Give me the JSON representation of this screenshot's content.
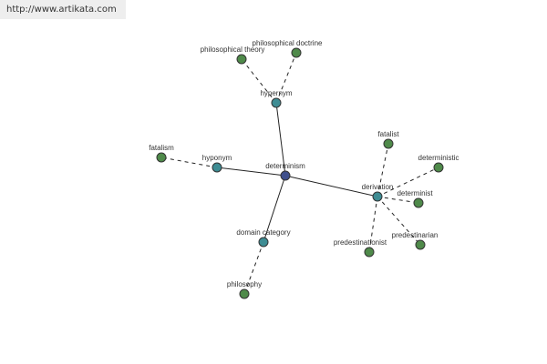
{
  "banner": {
    "url": "http://www.artikata.com"
  },
  "graph": {
    "colors": {
      "center": "#3f4f8c",
      "relation": "#3e8c93",
      "leaf": "#4f8a4a",
      "edge": "#222222"
    },
    "nodes": [
      {
        "id": "determinism",
        "label": "determinism",
        "type": "center"
      },
      {
        "id": "hypernym",
        "label": "hypernym",
        "type": "relation"
      },
      {
        "id": "hyponym",
        "label": "hyponym",
        "type": "relation"
      },
      {
        "id": "derivation",
        "label": "derivation",
        "type": "relation"
      },
      {
        "id": "domain-category",
        "label": "domain category",
        "type": "relation"
      },
      {
        "id": "philosophical-theory",
        "label": "philosophical theory",
        "type": "leaf"
      },
      {
        "id": "philosophical-doctrine",
        "label": "philosophical doctrine",
        "type": "leaf"
      },
      {
        "id": "fatalism",
        "label": "fatalism",
        "type": "leaf"
      },
      {
        "id": "fatalist",
        "label": "fatalist",
        "type": "leaf"
      },
      {
        "id": "deterministic",
        "label": "deterministic",
        "type": "leaf"
      },
      {
        "id": "determinist",
        "label": "determinist",
        "type": "leaf"
      },
      {
        "id": "predestinarian",
        "label": "predestinarian",
        "type": "leaf"
      },
      {
        "id": "predestinationist",
        "label": "predestinationist",
        "type": "leaf"
      },
      {
        "id": "philosophy",
        "label": "philosophy",
        "type": "leaf"
      }
    ],
    "edges": [
      {
        "from": "determinism",
        "to": "hypernym",
        "style": "solid"
      },
      {
        "from": "determinism",
        "to": "hyponym",
        "style": "solid"
      },
      {
        "from": "determinism",
        "to": "derivation",
        "style": "solid"
      },
      {
        "from": "determinism",
        "to": "domain-category",
        "style": "solid"
      },
      {
        "from": "hypernym",
        "to": "philosophical-theory",
        "style": "dashed"
      },
      {
        "from": "hypernym",
        "to": "philosophical-doctrine",
        "style": "dashed"
      },
      {
        "from": "hyponym",
        "to": "fatalism",
        "style": "dashed"
      },
      {
        "from": "derivation",
        "to": "fatalist",
        "style": "dashed"
      },
      {
        "from": "derivation",
        "to": "deterministic",
        "style": "dashed"
      },
      {
        "from": "derivation",
        "to": "determinist",
        "style": "dashed"
      },
      {
        "from": "derivation",
        "to": "predestinarian",
        "style": "dashed"
      },
      {
        "from": "derivation",
        "to": "predestinationist",
        "style": "dashed"
      },
      {
        "from": "domain-category",
        "to": "philosophy",
        "style": "dashed"
      }
    ]
  }
}
